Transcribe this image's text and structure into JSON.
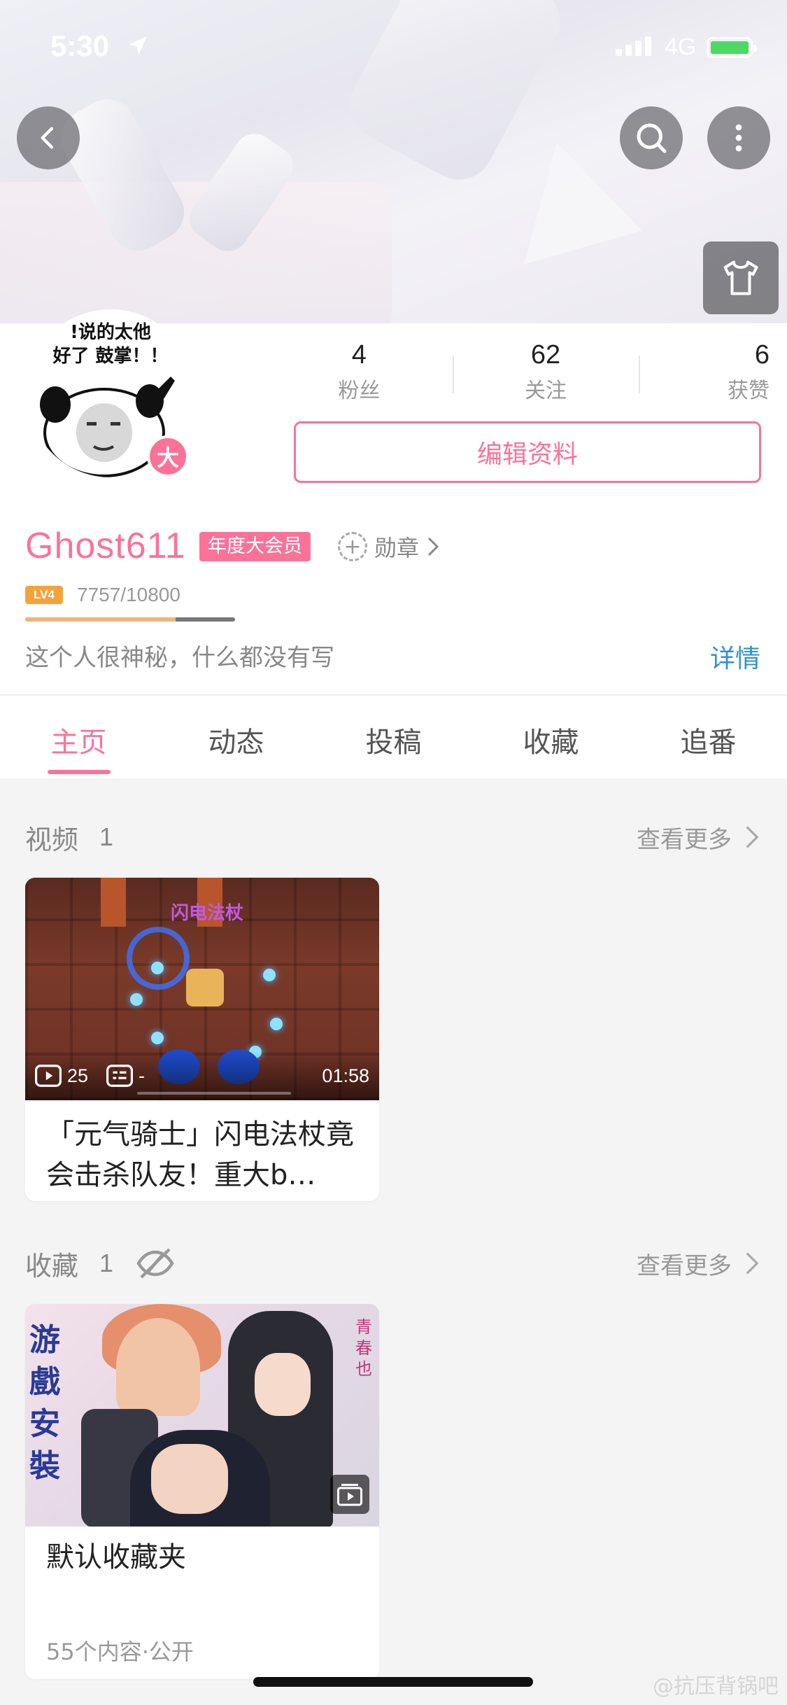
{
  "status_bar": {
    "time": "5:30",
    "network": "4G"
  },
  "header": {
    "back_icon": "chevron-left-icon",
    "search_icon": "search-icon",
    "more_icon": "more-vertical-icon",
    "skin_icon": "tshirt-icon"
  },
  "profile": {
    "avatar_text": "!说的太他\n好了 鼓掌！！",
    "vip_badge": "大",
    "stats": [
      {
        "num": "4",
        "label": "粉丝"
      },
      {
        "num": "62",
        "label": "关注"
      },
      {
        "num": "6",
        "label": "获赞"
      }
    ],
    "edit_button": "编辑资料",
    "username": "Ghost611",
    "vip_tag": "年度大会员",
    "medal_label": "勋章",
    "level_badge": "LV4",
    "exp_text": "7757/10800",
    "exp_fraction": 0.718,
    "sign": "这个人很神秘，什么都没有写",
    "detail_link": "详情"
  },
  "tabs": [
    "主页",
    "动态",
    "投稿",
    "收藏",
    "追番"
  ],
  "active_tab": 0,
  "video_section": {
    "title": "视频",
    "count": "1",
    "more": "查看更多",
    "video": {
      "thumb_label": "闪电法杖",
      "plays": "25",
      "danmaku": "-",
      "duration": "01:58",
      "title": "「元气骑士」闪电法杖竟会击杀队友！重大b…"
    }
  },
  "fav_section": {
    "title": "收藏",
    "count": "1",
    "more": "查看更多",
    "folder": {
      "thumb_side_text": "游戲安裝",
      "thumb_right_text": "青春也",
      "name": "默认收藏夹",
      "meta": "55个内容·公开"
    }
  },
  "watermark": "@抗压背锅吧",
  "colors": {
    "accent": "#fb7299",
    "link": "#2f8fd8"
  }
}
